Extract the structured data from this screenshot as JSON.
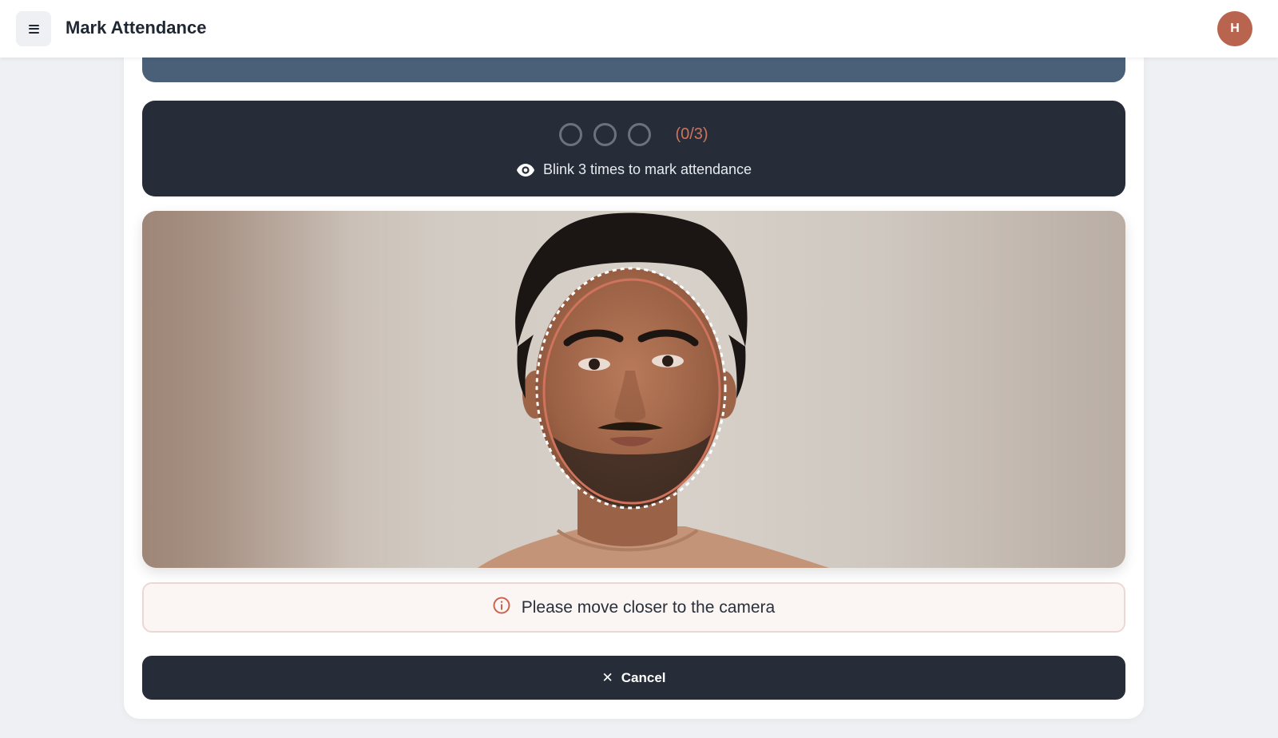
{
  "header": {
    "title": "Mark Attendance",
    "menu_icon": "hamburger-icon",
    "avatar_initial": "H"
  },
  "blink": {
    "progress_text": "(0/3)",
    "blinks_done": 0,
    "blinks_required": 3,
    "instruction": "Blink 3 times to mark attendance",
    "icon": "eye-icon"
  },
  "camera": {
    "guide_shape": "oval",
    "guide_color": "#d0735c"
  },
  "notice": {
    "icon": "info-icon",
    "text": "Please move closer to the camera"
  },
  "actions": {
    "cancel_icon": "close-icon",
    "cancel_label": "Cancel"
  },
  "colors": {
    "accent": "#d0735c",
    "panel": "#262d38",
    "band": "#4a6079",
    "avatar": "#b8644f"
  }
}
